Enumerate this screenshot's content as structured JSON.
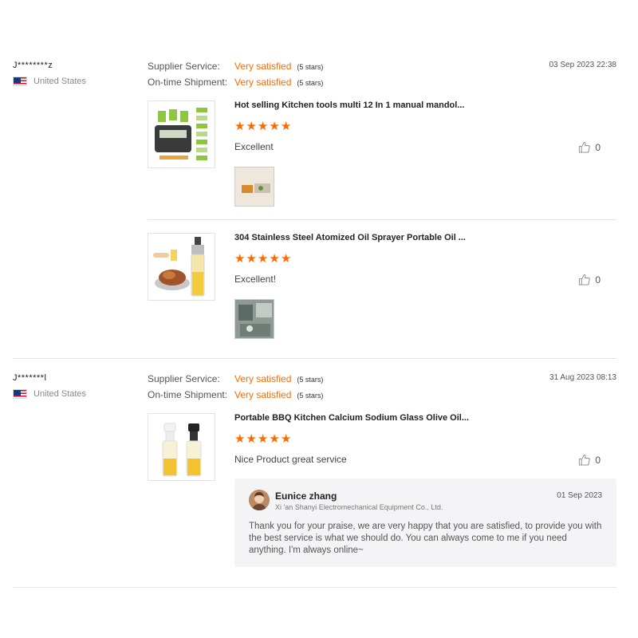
{
  "reviews": [
    {
      "buyer": "J********z",
      "country": "United States",
      "date": "03 Sep 2023 22:38",
      "supplier_service_label": "Supplier Service:",
      "supplier_service_value": "Very satisfied",
      "supplier_service_stars": "(5 stars)",
      "shipment_label": "On-time Shipment:",
      "shipment_value": "Very satisfied",
      "shipment_stars": "(5 stars)",
      "products": [
        {
          "title": "Hot selling Kitchen tools multi 12 In 1 manual mandol...",
          "rating": 5,
          "comment": "Excellent",
          "likes": "0"
        },
        {
          "title": "304 Stainless Steel Atomized Oil Sprayer Portable Oil ...",
          "rating": 5,
          "comment": "Excellent!",
          "likes": "0"
        }
      ]
    },
    {
      "buyer": "J*******l",
      "country": "United States",
      "date": "31 Aug 2023 08:13",
      "supplier_service_label": "Supplier Service:",
      "supplier_service_value": "Very satisfied",
      "supplier_service_stars": "(5 stars)",
      "shipment_label": "On-time Shipment:",
      "shipment_value": "Very satisfied",
      "shipment_stars": "(5 stars)",
      "products": [
        {
          "title": "Portable BBQ Kitchen Calcium Sodium Glass Olive Oil...",
          "rating": 5,
          "comment": "Nice Product great service",
          "likes": "0"
        }
      ],
      "reply": {
        "name": "Eunice zhang",
        "company": "Xi 'an Shanyi Electromechanical Equipment Co., Ltd.",
        "date": "01 Sep 2023",
        "text": "Thank you for your praise, we are very happy that you are satisfied, to provide you with the best service is what we should do. You can always come to me if you need anything. I'm always online~"
      }
    }
  ],
  "colors": {
    "accent": "#ff6a00",
    "divider": "#e5e5e5",
    "reply_bg": "#f4f4f6"
  },
  "icons": {
    "star": "star-icon",
    "like": "thumbs-up-icon",
    "flag": "us-flag-icon"
  }
}
